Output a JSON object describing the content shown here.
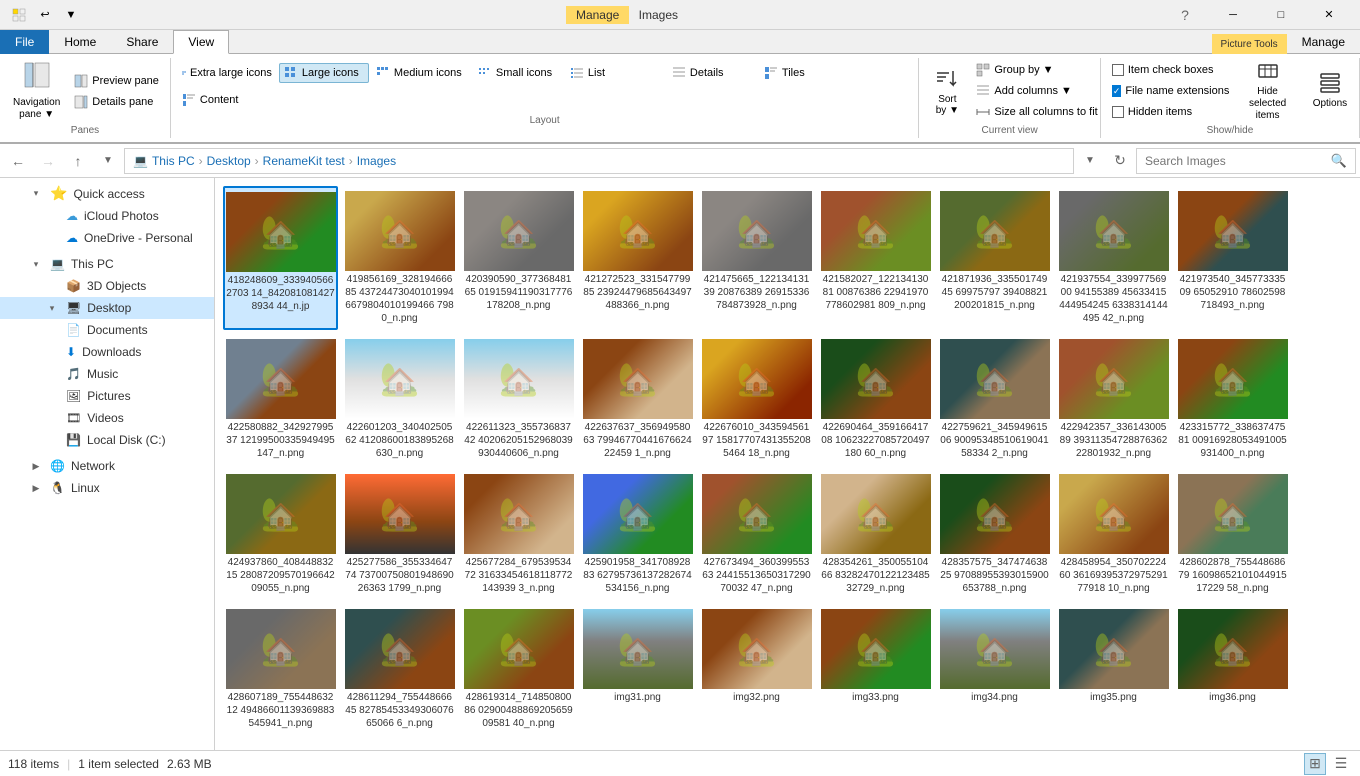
{
  "titlebar": {
    "quick_access": [
      "⬛",
      "↩",
      "▼"
    ],
    "title": "Images",
    "manage_label": "Manage",
    "minimize": "─",
    "maximize": "□",
    "close": "✕"
  },
  "ribbon": {
    "tabs": [
      {
        "id": "file",
        "label": "File",
        "type": "file"
      },
      {
        "id": "home",
        "label": "Home",
        "active": false
      },
      {
        "id": "share",
        "label": "Share",
        "active": false
      },
      {
        "id": "view",
        "label": "View",
        "active": true
      },
      {
        "id": "picture-tools",
        "label": "Picture Tools",
        "type": "special"
      }
    ],
    "panes_group": {
      "label": "Panes",
      "items": [
        {
          "id": "nav-pane",
          "label": "Navigation\npane ▼",
          "icon": "🗂"
        },
        {
          "id": "preview-pane",
          "label": "Preview pane",
          "icon": "◫"
        },
        {
          "id": "details-pane",
          "label": "Details pane",
          "icon": "☰"
        }
      ]
    },
    "layout_group": {
      "label": "Layout",
      "items": [
        {
          "label": "Extra large icons"
        },
        {
          "label": "Large icons",
          "active": true
        },
        {
          "label": "Medium icons"
        },
        {
          "label": "Small icons"
        },
        {
          "label": "List"
        },
        {
          "label": "Details"
        },
        {
          "label": "Tiles"
        },
        {
          "label": "Content"
        }
      ]
    },
    "current_view_group": {
      "label": "Current view",
      "sort_label": "Sort\nby ▼",
      "group_label": "Group by ▼",
      "add_columns": "Add columns ▼",
      "size_columns": "Size all columns to fit"
    },
    "show_hide_group": {
      "label": "Show/hide",
      "item_checkboxes": "Item check boxes",
      "file_extensions": "File name extensions",
      "hidden_items": "Hidden items",
      "file_ext_checked": true,
      "item_check_checked": false,
      "hidden_checked": false,
      "hide_selected_label": "Hide selected\nitems",
      "options_label": "Options"
    }
  },
  "navbar": {
    "back_disabled": false,
    "forward_disabled": true,
    "up_disabled": false,
    "refresh_disabled": false,
    "path": [
      "This PC",
      "Desktop",
      "RenameKit test",
      "Images"
    ],
    "search_placeholder": "Search Images",
    "search_label": "Search Images"
  },
  "sidebar": {
    "items": [
      {
        "id": "quick-access",
        "label": "Quick access",
        "icon": "⭐",
        "level": 0,
        "expanded": true
      },
      {
        "id": "icloud",
        "label": "iCloud Photos",
        "icon": "☁",
        "level": 1
      },
      {
        "id": "onedrive",
        "label": "OneDrive - Personal",
        "icon": "☁",
        "level": 1
      },
      {
        "id": "this-pc",
        "label": "This PC",
        "icon": "💻",
        "level": 0,
        "expanded": true
      },
      {
        "id": "3d-objects",
        "label": "3D Objects",
        "icon": "📦",
        "level": 1
      },
      {
        "id": "desktop",
        "label": "Desktop",
        "icon": "🖥",
        "level": 1,
        "selected": true
      },
      {
        "id": "documents",
        "label": "Documents",
        "icon": "📄",
        "level": 1
      },
      {
        "id": "downloads",
        "label": "Downloads",
        "icon": "⬇",
        "level": 1
      },
      {
        "id": "music",
        "label": "Music",
        "icon": "🎵",
        "level": 1
      },
      {
        "id": "pictures",
        "label": "Pictures",
        "icon": "🖼",
        "level": 1
      },
      {
        "id": "videos",
        "label": "Videos",
        "icon": "🎞",
        "level": 1
      },
      {
        "id": "local-disk",
        "label": "Local Disk (C:)",
        "icon": "💾",
        "level": 1
      },
      {
        "id": "network",
        "label": "Network",
        "icon": "🌐",
        "level": 0
      },
      {
        "id": "linux",
        "label": "Linux",
        "icon": "🐧",
        "level": 0
      }
    ]
  },
  "files": {
    "items": [
      {
        "name": "418248609_3339405662703 14_8420810814278934 44_n.jp",
        "thumb": "thumb-1",
        "selected": true
      },
      {
        "name": "419856169_32819466685 43724473040101994 6679804010199466 7980_n.png",
        "thumb": "thumb-c1"
      },
      {
        "name": "420390590_37736848165 01915941190317776 178208_n.png",
        "thumb": "thumb-5"
      },
      {
        "name": "421272523_33154779985 23924479685643497 488366_n.png",
        "thumb": "thumb-4"
      },
      {
        "name": "421475665_12213413139 20876389 26915336784873928_n.png",
        "thumb": "thumb-5"
      },
      {
        "name": "421582027_12213413081 00876386 22941970778602981 809_n.png",
        "thumb": "thumb-7"
      },
      {
        "name": "421871936_33550174945 69975797 39408821200201815_n.png",
        "thumb": "thumb-2"
      },
      {
        "name": "421937554_33997756900 94155389 45633415444954245 6338314144495 42_n.png",
        "thumb": "thumb-8"
      },
      {
        "name": "421973540_34577333509 65052910 78602598718493_n.png",
        "thumb": "thumb-6"
      },
      {
        "name": "422580882_34292799537 12199500335949495 147_n.png",
        "thumb": "thumb-c2"
      },
      {
        "name": "422601203_34040250562 41208600183895268 630_n.png",
        "thumb": "thumb-snow"
      },
      {
        "name": "422611323_35573683742 40206205152968039 930440606_n.png",
        "thumb": "thumb-snow"
      },
      {
        "name": "422637637_35694958063 79946770441676624 22459 1_n.png",
        "thumb": "thumb-c3"
      },
      {
        "name": "422676010_34359456197 15817707431355208 5464 18_n.png",
        "thumb": "thumb-warm"
      },
      {
        "name": "422690464_35916641708 10623227085720497 180 60_n.png",
        "thumb": "thumb-forest"
      },
      {
        "name": "422759621_34594961506 90095348510619041 58334 2_n.png",
        "thumb": "thumb-c4"
      },
      {
        "name": "422942357_33614300589 39311354728876362 22801932_n.png",
        "thumb": "thumb-7"
      },
      {
        "name": "423315772_33863747581 00916928053491005 931400_n.png",
        "thumb": "thumb-1"
      },
      {
        "name": "424937860_40844883215 28087209570196642 09055_n.png",
        "thumb": "thumb-2"
      },
      {
        "name": "425277586_35533464774 73700750801948690 26363 1799_n.png",
        "thumb": "thumb-dusk"
      },
      {
        "name": "425677284_67953953472 31633454618118772 143939 3_n.png",
        "thumb": "thumb-ext1"
      },
      {
        "name": "425901958_34170892883 62795736137282674 534156_n.png",
        "thumb": "thumb-stream"
      },
      {
        "name": "427673494_36039955363 24415513650317290 70032 47_n.png",
        "thumb": "thumb-c5"
      },
      {
        "name": "428354261_35005510466 83282470122123485 32729_n.png",
        "thumb": "thumb-int"
      },
      {
        "name": "428357575_34747463825 97088955393015900 653788_n.png",
        "thumb": "thumb-forest"
      },
      {
        "name": "428458954_35070222460 36169395372975291 77918 10_n.png",
        "thumb": "thumb-c1"
      },
      {
        "name": "428602878_75544868679 16098652101044915 17229 58_n.png",
        "thumb": "thumb-9"
      },
      {
        "name": "428607189_75544863212 49486601139369883 545941_n.png",
        "thumb": "thumb-3"
      },
      {
        "name": "428611294_75544866645 82785453349306076 65066 6_n.png",
        "thumb": "thumb-10"
      },
      {
        "name": "428619314_71485080086 02900488869205659 09581 40_n.png",
        "thumb": "thumb-12"
      },
      {
        "name": "img31.png",
        "thumb": "thumb-mtn"
      },
      {
        "name": "img32.png",
        "thumb": "thumb-c3"
      },
      {
        "name": "img33.png",
        "thumb": "thumb-1"
      },
      {
        "name": "img34.png",
        "thumb": "thumb-mtn"
      },
      {
        "name": "img35.png",
        "thumb": "thumb-c4"
      },
      {
        "name": "img36.png",
        "thumb": "thumb-forest"
      }
    ]
  },
  "statusbar": {
    "count": "118 items",
    "selected": "1 item selected",
    "size": "2.63 MB"
  },
  "colors": {
    "accent": "#0078d4",
    "selected_bg": "#cce8ff",
    "selected_border": "#0078d4",
    "ribbon_bg": "#f0f0f0",
    "file_tab": "#1a6fb5",
    "picture_tools_tab": "#ffd966"
  }
}
